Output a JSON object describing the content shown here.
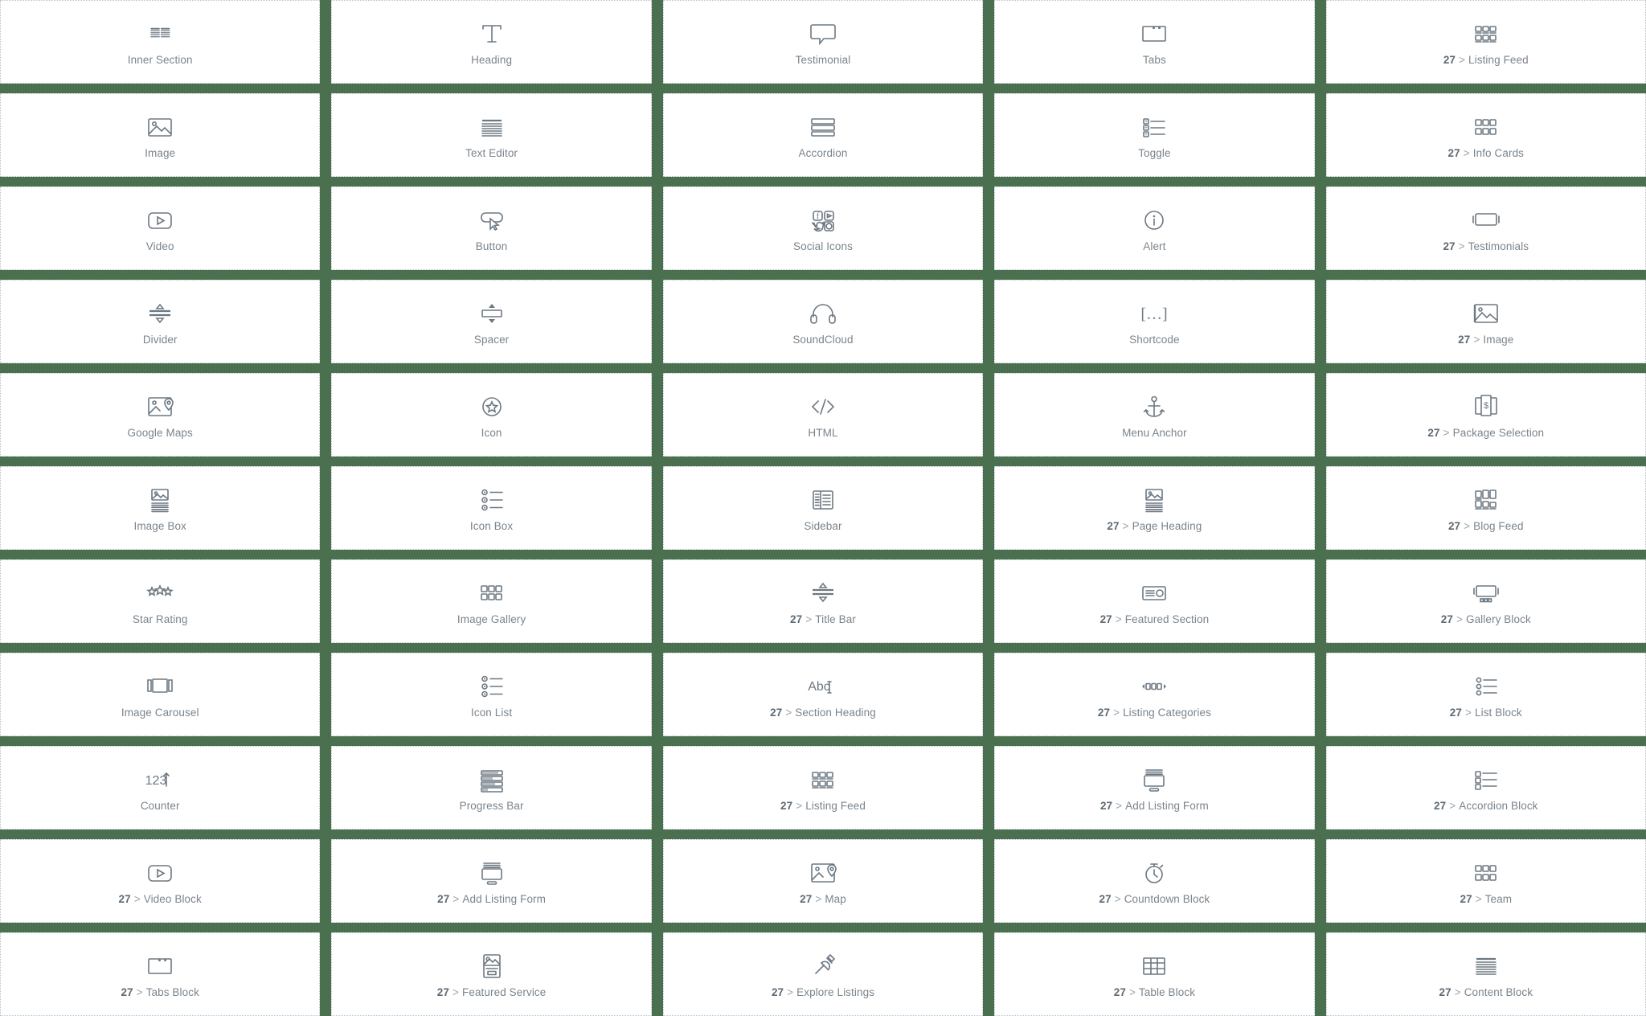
{
  "panel": {
    "accent_color": "#4a7050",
    "card_bg": "#ffffff",
    "icon_color": "#6d7882",
    "label_color": "#7a848c",
    "prefix_color": "#5f6a73",
    "columns": 5,
    "prefix": "27",
    "separator": ">"
  },
  "widgets": [
    {
      "label": "Inner Section",
      "prefix": "",
      "icon": "inner-section-icon"
    },
    {
      "label": "Heading",
      "prefix": "",
      "icon": "heading-icon"
    },
    {
      "label": "Testimonial",
      "prefix": "",
      "icon": "testimonial-icon"
    },
    {
      "label": "Tabs",
      "prefix": "",
      "icon": "tabs-icon"
    },
    {
      "label": "Listing Feed",
      "prefix": "27",
      "icon": "listing-feed-icon"
    },
    {
      "label": "Image",
      "prefix": "",
      "icon": "image-icon"
    },
    {
      "label": "Text Editor",
      "prefix": "",
      "icon": "text-editor-icon"
    },
    {
      "label": "Accordion",
      "prefix": "",
      "icon": "accordion-icon"
    },
    {
      "label": "Toggle",
      "prefix": "",
      "icon": "toggle-icon"
    },
    {
      "label": "Info Cards",
      "prefix": "27",
      "icon": "info-cards-icon"
    },
    {
      "label": "Video",
      "prefix": "",
      "icon": "video-icon"
    },
    {
      "label": "Button",
      "prefix": "",
      "icon": "button-icon"
    },
    {
      "label": "Social Icons",
      "prefix": "",
      "icon": "social-icons-icon"
    },
    {
      "label": "Alert",
      "prefix": "",
      "icon": "alert-icon"
    },
    {
      "label": "Testimonials",
      "prefix": "27",
      "icon": "testimonials-icon"
    },
    {
      "label": "Divider",
      "prefix": "",
      "icon": "divider-icon"
    },
    {
      "label": "Spacer",
      "prefix": "",
      "icon": "spacer-icon"
    },
    {
      "label": "SoundCloud",
      "prefix": "",
      "icon": "soundcloud-icon"
    },
    {
      "label": "Shortcode",
      "prefix": "",
      "icon": "shortcode-icon"
    },
    {
      "label": "Image",
      "prefix": "27",
      "icon": "image-placeholder-icon"
    },
    {
      "label": "Google Maps",
      "prefix": "",
      "icon": "google-maps-icon"
    },
    {
      "label": "Icon",
      "prefix": "",
      "icon": "star-circle-icon"
    },
    {
      "label": "HTML",
      "prefix": "",
      "icon": "html-code-icon"
    },
    {
      "label": "Menu Anchor",
      "prefix": "",
      "icon": "anchor-icon"
    },
    {
      "label": "Package Selection",
      "prefix": "27",
      "icon": "package-selection-icon"
    },
    {
      "label": "Image Box",
      "prefix": "",
      "icon": "image-box-icon"
    },
    {
      "label": "Icon Box",
      "prefix": "",
      "icon": "icon-box-icon"
    },
    {
      "label": "Sidebar",
      "prefix": "",
      "icon": "sidebar-icon"
    },
    {
      "label": "Page Heading",
      "prefix": "27",
      "icon": "page-heading-icon"
    },
    {
      "label": "Blog Feed",
      "prefix": "27",
      "icon": "blog-feed-icon"
    },
    {
      "label": "Star Rating",
      "prefix": "",
      "icon": "star-rating-icon"
    },
    {
      "label": "Image Gallery",
      "prefix": "",
      "icon": "image-gallery-icon"
    },
    {
      "label": "Title Bar",
      "prefix": "27",
      "icon": "title-bar-icon"
    },
    {
      "label": "Featured Section",
      "prefix": "27",
      "icon": "featured-section-icon"
    },
    {
      "label": "Gallery Block",
      "prefix": "27",
      "icon": "gallery-block-icon"
    },
    {
      "label": "Image Carousel",
      "prefix": "",
      "icon": "image-carousel-icon"
    },
    {
      "label": "Icon List",
      "prefix": "",
      "icon": "icon-list-icon"
    },
    {
      "label": "Section Heading",
      "prefix": "27",
      "icon": "section-heading-icon"
    },
    {
      "label": "Listing Categories",
      "prefix": "27",
      "icon": "listing-categories-icon"
    },
    {
      "label": "List Block",
      "prefix": "27",
      "icon": "list-block-icon"
    },
    {
      "label": "Counter",
      "prefix": "",
      "icon": "counter-icon"
    },
    {
      "label": "Progress Bar",
      "prefix": "",
      "icon": "progress-bar-icon"
    },
    {
      "label": "Listing Feed",
      "prefix": "27",
      "icon": "listing-feed-grid-icon"
    },
    {
      "label": "Add Listing Form",
      "prefix": "27",
      "icon": "add-listing-form-icon"
    },
    {
      "label": "Accordion Block",
      "prefix": "27",
      "icon": "accordion-block-icon"
    },
    {
      "label": "Video Block",
      "prefix": "27",
      "icon": "video-block-icon"
    },
    {
      "label": "Add Listing Form",
      "prefix": "27",
      "icon": "add-listing-form-icon"
    },
    {
      "label": "Map",
      "prefix": "27",
      "icon": "map-icon"
    },
    {
      "label": "Countdown Block",
      "prefix": "27",
      "icon": "countdown-icon"
    },
    {
      "label": "Team",
      "prefix": "27",
      "icon": "team-icon"
    },
    {
      "label": "Tabs Block",
      "prefix": "27",
      "icon": "tabs-block-icon"
    },
    {
      "label": "Featured Service",
      "prefix": "27",
      "icon": "featured-service-icon"
    },
    {
      "label": "Explore Listings",
      "prefix": "27",
      "icon": "explore-listings-icon"
    },
    {
      "label": "Table Block",
      "prefix": "27",
      "icon": "table-block-icon"
    },
    {
      "label": "Content Block",
      "prefix": "27",
      "icon": "content-block-icon"
    }
  ]
}
